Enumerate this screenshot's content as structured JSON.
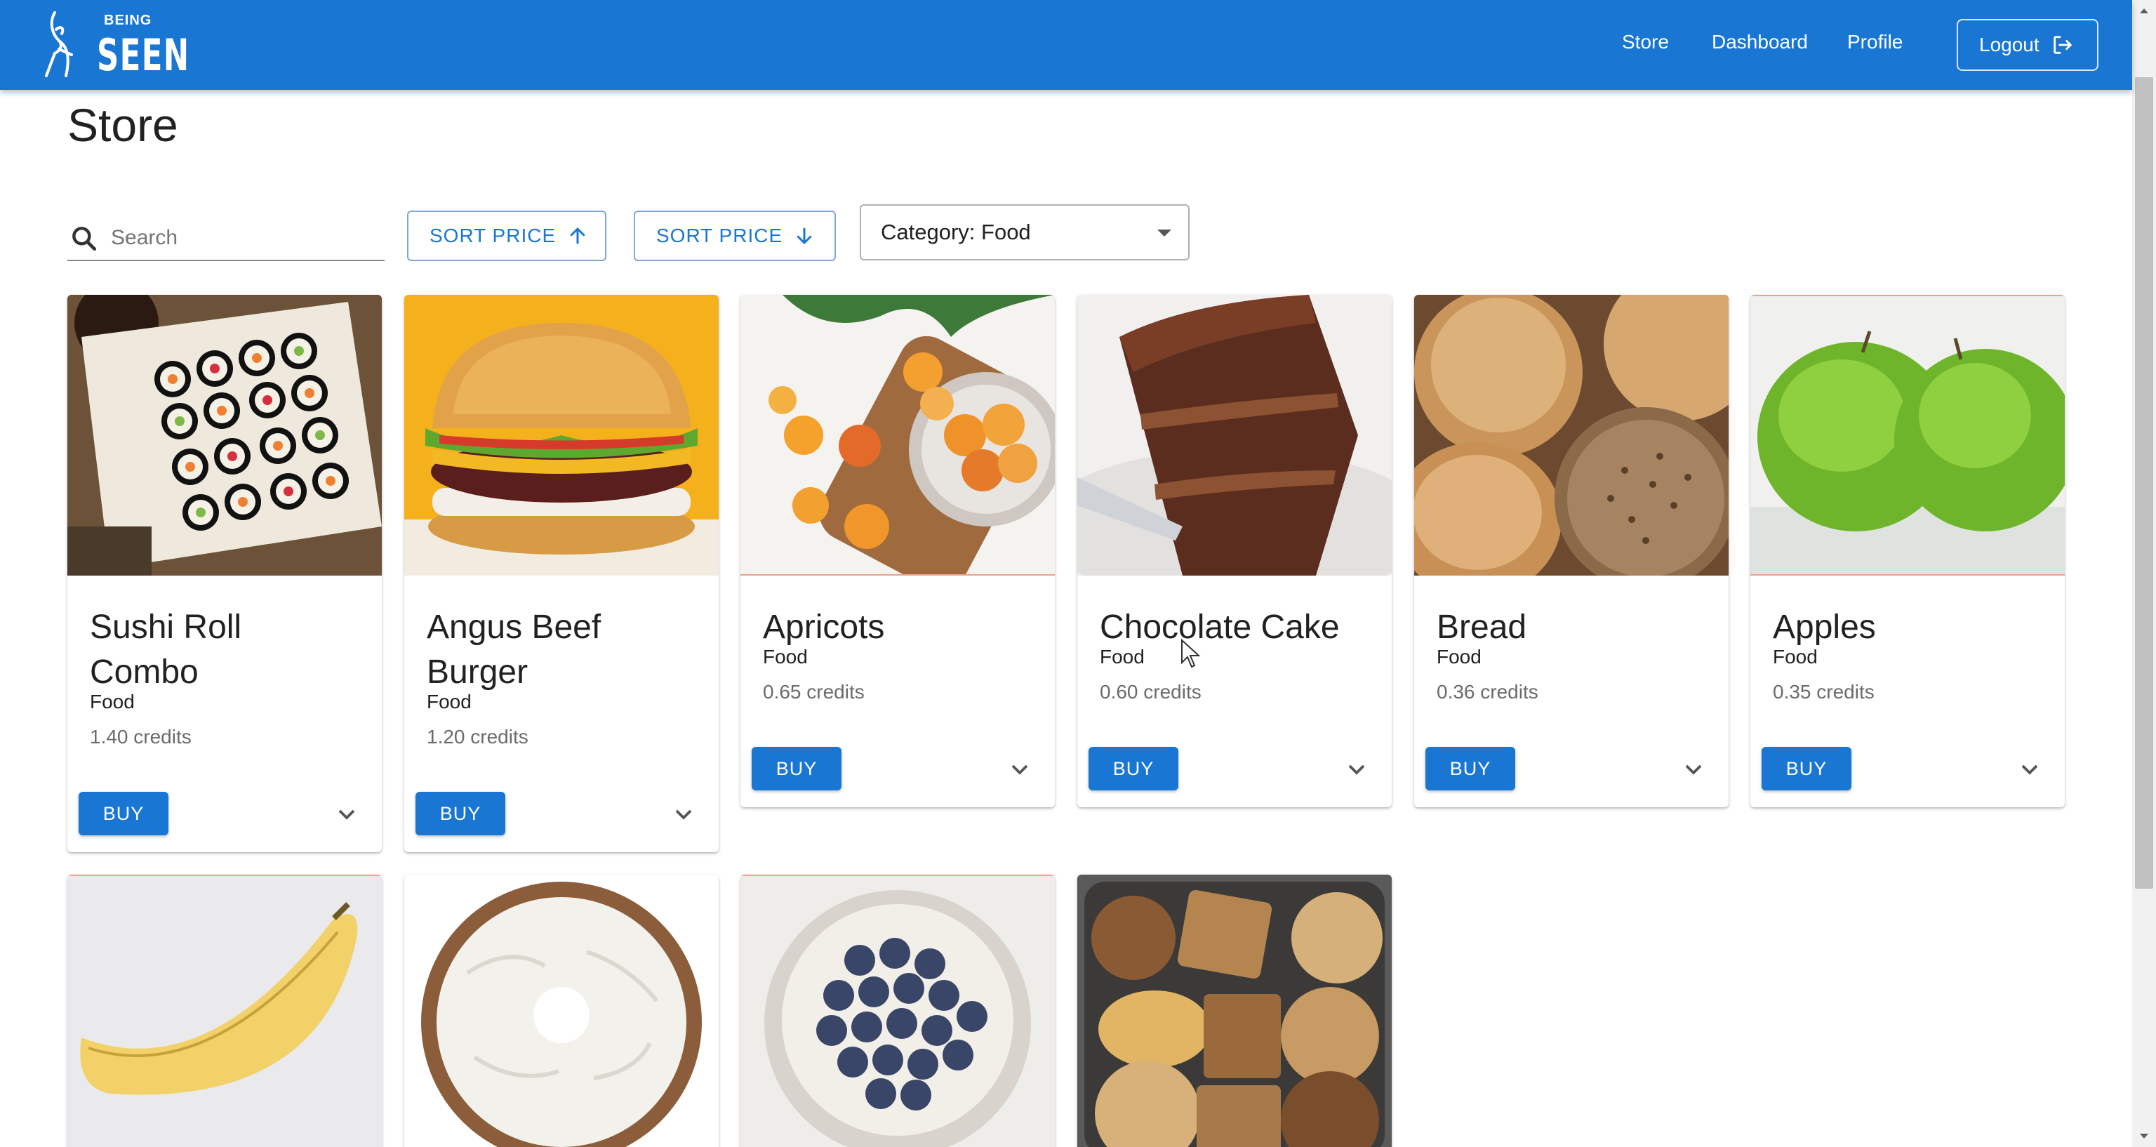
{
  "brand": {
    "line1": "BEING",
    "line2": "SEEN",
    "accent": "#1976d2"
  },
  "nav": {
    "store": "Store",
    "dashboard": "Dashboard",
    "profile": "Profile",
    "logout": "Logout"
  },
  "page": {
    "title": "Store"
  },
  "toolbar": {
    "search_placeholder": "Search",
    "sort_asc_label": "SORT PRICE",
    "sort_desc_label": "SORT PRICE",
    "category_label": "Category: Food"
  },
  "buy_label": "BUY",
  "products": [
    {
      "name": "Sushi Roll Combo",
      "category": "Food",
      "price": "1.40 credits",
      "image_icon": "sushi-image"
    },
    {
      "name": "Angus Beef Burger",
      "category": "Food",
      "price": "1.20 credits",
      "image_icon": "burger-image"
    },
    {
      "name": "Apricots",
      "category": "Food",
      "price": "0.65 credits",
      "image_icon": "apricots-image"
    },
    {
      "name": "Chocolate Cake",
      "category": "Food",
      "price": "0.60 credits",
      "image_icon": "cake-image"
    },
    {
      "name": "Bread",
      "category": "Food",
      "price": "0.36 credits",
      "image_icon": "bread-image"
    },
    {
      "name": "Apples",
      "category": "Food",
      "price": "0.35 credits",
      "image_icon": "apples-image"
    }
  ],
  "more_products_icons": [
    "banana-image",
    "bagel-image",
    "blueberries-image",
    "cookies-image"
  ]
}
